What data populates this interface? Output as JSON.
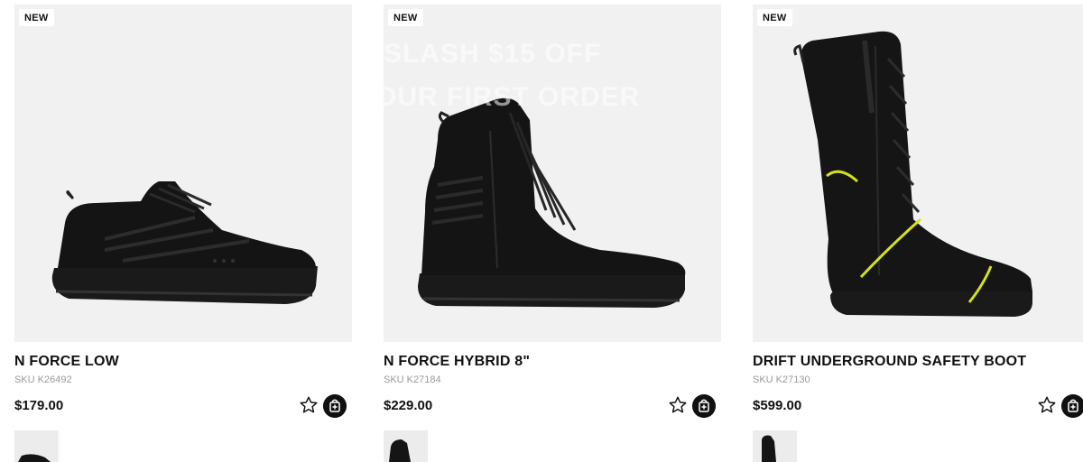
{
  "products": [
    {
      "badge": "NEW",
      "name": "N FORCE LOW",
      "sku": "SKU K26492",
      "price": "$179.00"
    },
    {
      "badge": "NEW",
      "name": "N FORCE HYBRID 8\"",
      "sku": "SKU K27184",
      "price": "$229.00"
    },
    {
      "badge": "NEW",
      "name": "DRIFT UNDERGROUND SAFETY BOOT",
      "sku": "SKU K27130",
      "price": "$599.00"
    }
  ],
  "icons": {
    "favorite": "star-outline-icon",
    "add_to_cart": "shopping-bag-plus-icon"
  },
  "colors": {
    "image_bg": "#f1f1f1",
    "text": "#111111",
    "sku": "#9a9a9a",
    "accent_stripe": "#d4e21a"
  }
}
